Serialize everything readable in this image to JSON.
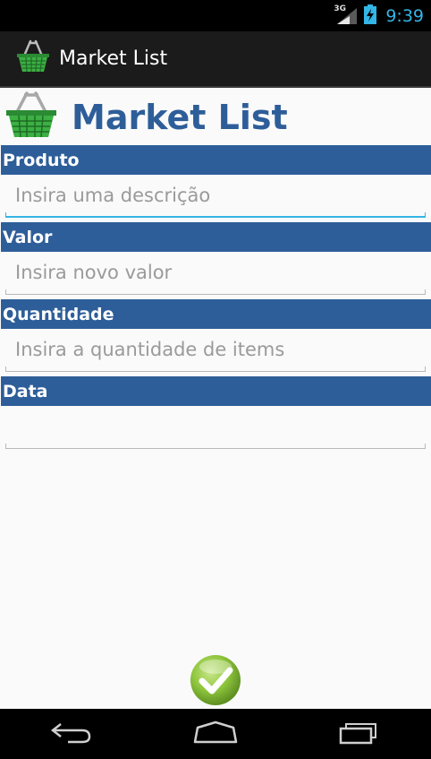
{
  "status_bar": {
    "network": "3G",
    "time": "9:39"
  },
  "action_bar": {
    "title": "Market List",
    "icon": "basket-icon"
  },
  "header": {
    "title": "Market List",
    "icon": "basket-icon"
  },
  "form": {
    "produto": {
      "label": "Produto",
      "placeholder": "Insira uma descrição",
      "value": ""
    },
    "valor": {
      "label": "Valor",
      "placeholder": "Insira novo valor",
      "value": ""
    },
    "quantidade": {
      "label": "Quantidade",
      "placeholder": "Insira a quantidade de items",
      "value": ""
    },
    "data": {
      "label": "Data",
      "placeholder": "",
      "value": ""
    }
  },
  "confirm": {
    "icon": "checkmark-icon"
  },
  "nav": {
    "back": "back-icon",
    "home": "home-icon",
    "recents": "recents-icon"
  },
  "colors": {
    "section_bar": "#2e5e99",
    "header_text": "#2e5e99",
    "accent": "#33b5e5",
    "basket": "#3cb043",
    "confirm": "#8fc63d"
  }
}
